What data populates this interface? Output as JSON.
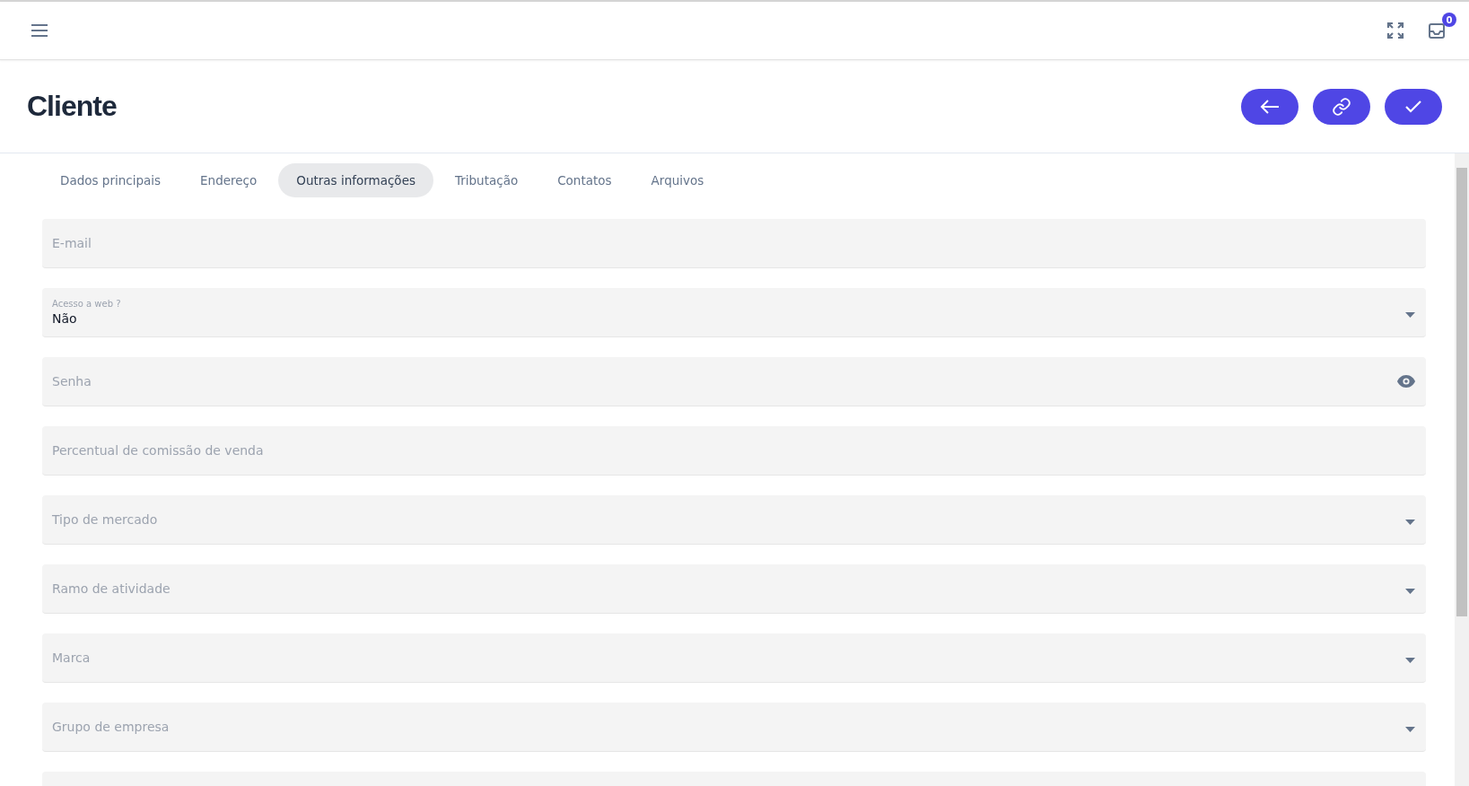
{
  "topbar": {
    "notification_count": "0"
  },
  "page": {
    "title": "Cliente"
  },
  "tabs": [
    {
      "label": "Dados principais",
      "selected": false
    },
    {
      "label": "Endereço",
      "selected": false
    },
    {
      "label": "Outras informações",
      "selected": true
    },
    {
      "label": "Tributação",
      "selected": false
    },
    {
      "label": "Contatos",
      "selected": false
    },
    {
      "label": "Arquivos",
      "selected": false
    }
  ],
  "fields": [
    {
      "kind": "text",
      "label": "E-mail"
    },
    {
      "kind": "select",
      "label": "Acesso a web ?",
      "value": "Não"
    },
    {
      "kind": "password",
      "label": "Senha"
    },
    {
      "kind": "text",
      "label": "Percentual de comissão de venda"
    },
    {
      "kind": "select",
      "label": "Tipo de mercado"
    },
    {
      "kind": "select",
      "label": "Ramo de atividade"
    },
    {
      "kind": "select",
      "label": "Marca"
    },
    {
      "kind": "select",
      "label": "Grupo de empresa"
    }
  ]
}
